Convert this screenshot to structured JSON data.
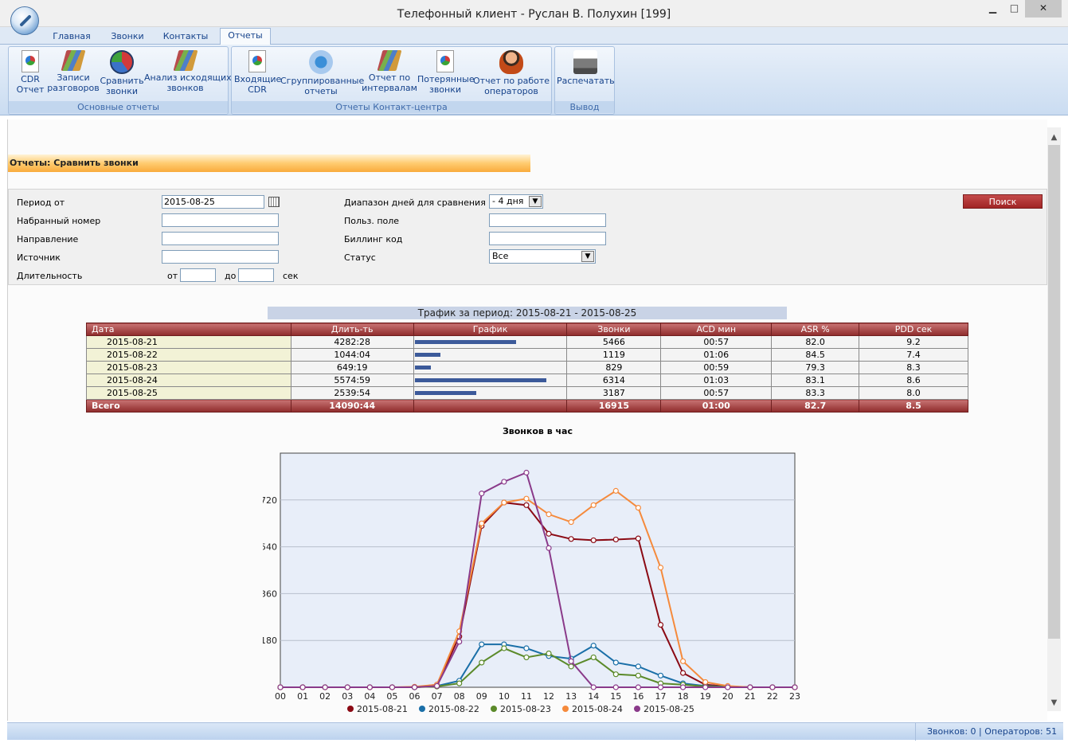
{
  "window": {
    "title": "Телефонный клиент - Руслан В. Полухин [199]"
  },
  "tabs": [
    "Главная",
    "Звонки",
    "Контакты",
    "Отчеты"
  ],
  "ribbon": {
    "groups": [
      {
        "label": "Основные отчеты",
        "buttons": [
          "CDR\nОтчет",
          "Записи\nразговоров",
          "Сравнить\nзвонки",
          "Анализ исходящих\nзвонков"
        ]
      },
      {
        "label": "Отчеты Контакт-центра",
        "buttons": [
          "Входящие\nCDR",
          "Сгруппированные\nотчеты",
          "Отчет по\nинтервалам",
          "Потерянные\nзвонки",
          "Отчет по работе\nоператоров"
        ]
      },
      {
        "label": "Вывод",
        "buttons": [
          "Распечатать"
        ]
      }
    ]
  },
  "page": {
    "header": "Отчеты: Сравнить звонки"
  },
  "filters": {
    "period_label": "Период от",
    "period_value": "2015-08-25",
    "dialed_label": "Набранный номер",
    "direction_label": "Направление",
    "source_label": "Источник",
    "duration_label": "Длительность",
    "from_label": "от",
    "to_label": "до",
    "sec_label": "сек",
    "range_label": "Диапазон дней для сравнения",
    "range_value": "- 4 дня",
    "custom_label": "Польз. поле",
    "billing_label": "Биллинг код",
    "status_label": "Статус",
    "status_value": "Все",
    "search_button": "Поиск"
  },
  "traffic": {
    "title": "Трафик за период: 2015-08-21 - 2015-08-25",
    "columns": [
      "Дата",
      "Длить-ть",
      "График",
      "Звонки",
      "ACD мин",
      "ASR %",
      "PDD сек"
    ],
    "rows": [
      {
        "date": "2015-08-21",
        "duration": "4282:28",
        "graph": 0.68,
        "calls": "5466",
        "acd": "00:57",
        "asr": "82.0",
        "pdd": "9.2"
      },
      {
        "date": "2015-08-22",
        "duration": "1044:04",
        "graph": 0.17,
        "calls": "1119",
        "acd": "01:06",
        "asr": "84.5",
        "pdd": "7.4"
      },
      {
        "date": "2015-08-23",
        "duration": "649:19",
        "graph": 0.11,
        "calls": "829",
        "acd": "00:59",
        "asr": "79.3",
        "pdd": "8.3"
      },
      {
        "date": "2015-08-24",
        "duration": "5574:59",
        "graph": 0.88,
        "calls": "6314",
        "acd": "01:03",
        "asr": "83.1",
        "pdd": "8.6"
      },
      {
        "date": "2015-08-25",
        "duration": "2539:54",
        "graph": 0.41,
        "calls": "3187",
        "acd": "00:57",
        "asr": "83.3",
        "pdd": "8.0"
      }
    ],
    "total": {
      "date": "Всего",
      "duration": "14090:44",
      "graph": "",
      "calls": "16915",
      "acd": "01:00",
      "asr": "82.7",
      "pdd": "8.5"
    }
  },
  "chart_data": {
    "type": "line",
    "title": "Звонков в час",
    "x": [
      "00",
      "01",
      "02",
      "03",
      "04",
      "05",
      "06",
      "07",
      "08",
      "09",
      "10",
      "11",
      "12",
      "13",
      "14",
      "15",
      "16",
      "17",
      "18",
      "19",
      "20",
      "21",
      "22",
      "23"
    ],
    "yticks": [
      180,
      360,
      540,
      720
    ],
    "ylim": [
      0,
      900
    ],
    "grid": true,
    "legend_position": "bottom",
    "series": [
      {
        "name": "2015-08-21",
        "color": "#8b0a14",
        "values": [
          0,
          0,
          0,
          0,
          0,
          0,
          0,
          10,
          195,
          620,
          710,
          700,
          590,
          570,
          565,
          568,
          572,
          240,
          55,
          10,
          3,
          0,
          0,
          0
        ]
      },
      {
        "name": "2015-08-22",
        "color": "#1a6fa8",
        "values": [
          0,
          0,
          0,
          0,
          0,
          0,
          0,
          5,
          25,
          165,
          165,
          150,
          120,
          110,
          160,
          95,
          80,
          45,
          15,
          5,
          2,
          0,
          0,
          0
        ]
      },
      {
        "name": "2015-08-23",
        "color": "#5b8a2a",
        "values": [
          0,
          0,
          0,
          0,
          0,
          0,
          0,
          3,
          15,
          95,
          150,
          115,
          130,
          80,
          115,
          50,
          45,
          15,
          10,
          3,
          1,
          0,
          0,
          0
        ]
      },
      {
        "name": "2015-08-24",
        "color": "#f58a3c",
        "values": [
          0,
          0,
          0,
          0,
          0,
          0,
          2,
          10,
          215,
          630,
          710,
          725,
          665,
          635,
          700,
          755,
          690,
          460,
          100,
          20,
          5,
          0,
          0,
          0
        ]
      },
      {
        "name": "2015-08-25",
        "color": "#8a3a8a",
        "values": [
          0,
          0,
          0,
          0,
          0,
          0,
          0,
          5,
          175,
          745,
          790,
          825,
          535,
          100,
          0,
          0,
          0,
          0,
          0,
          0,
          0,
          0,
          0,
          0
        ]
      }
    ]
  },
  "statusbar": {
    "text": "Звонков: 0 | Операторов: 51"
  }
}
